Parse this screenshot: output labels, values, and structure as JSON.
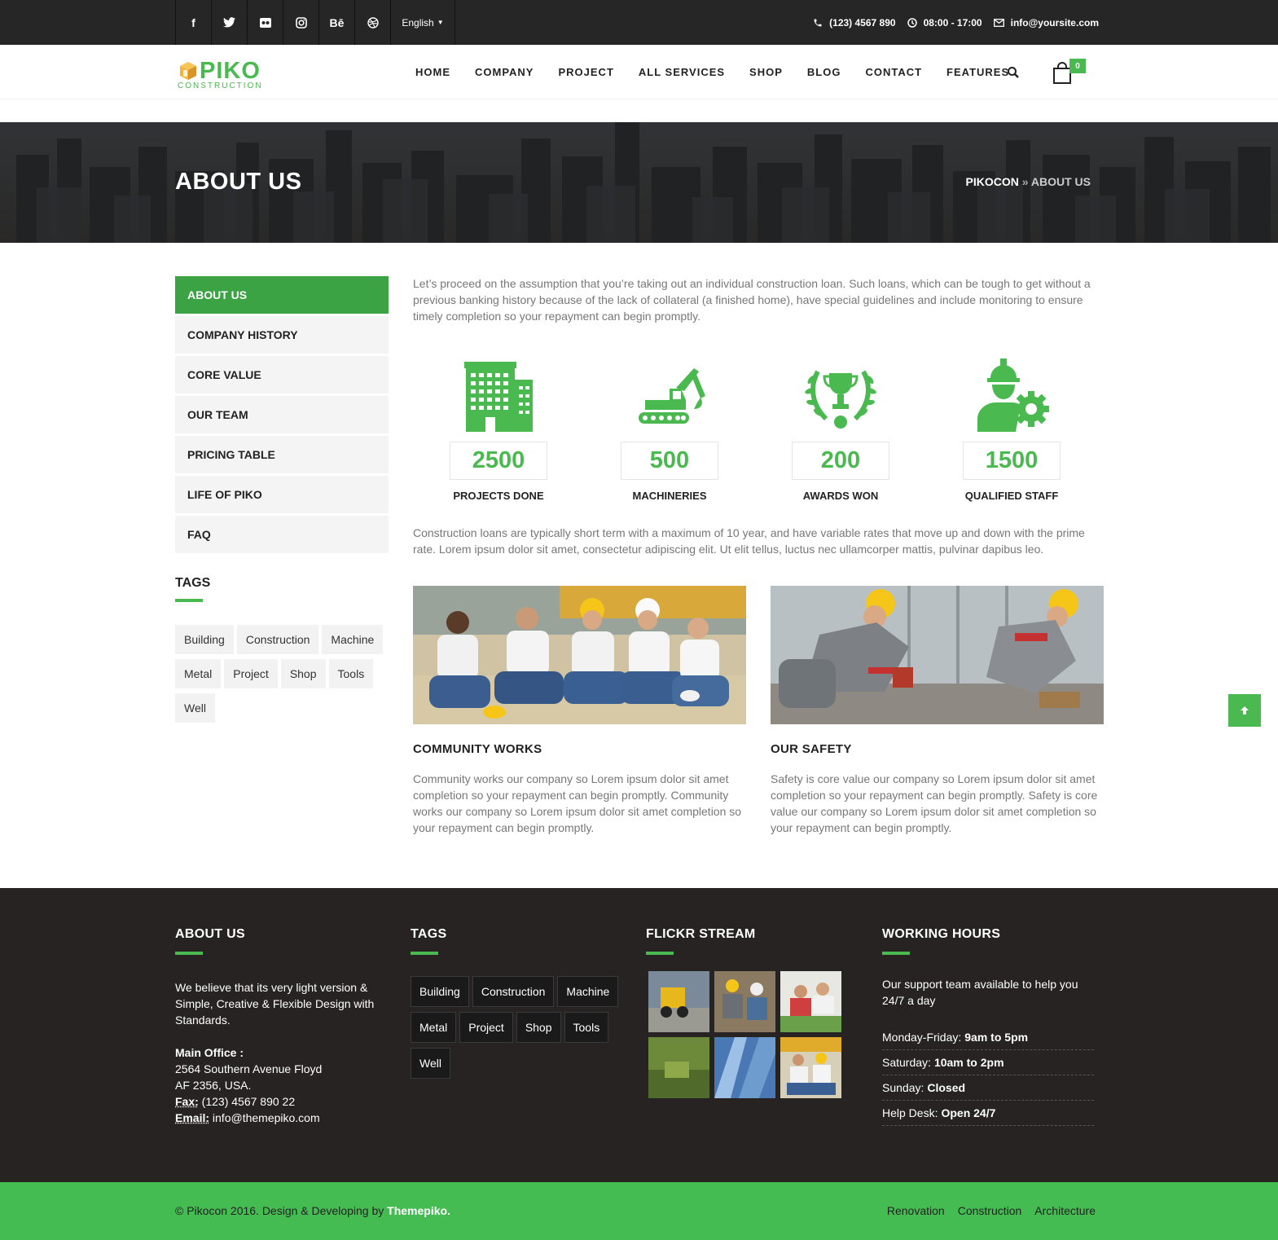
{
  "topbar": {
    "social": [
      {
        "icon": "facebook-icon",
        "glyph": "f"
      },
      {
        "icon": "twitter-icon",
        "glyph": "t"
      },
      {
        "icon": "flickr-icon",
        "glyph": "●●"
      },
      {
        "icon": "instagram-icon",
        "glyph": "◎"
      },
      {
        "icon": "behance-icon",
        "glyph": "Bē"
      },
      {
        "icon": "dribbble-icon",
        "glyph": "⊛"
      }
    ],
    "language": "English",
    "phone": "(123) 4567 890",
    "hours": "08:00 - 17:00",
    "email": "info@yoursite.com"
  },
  "header": {
    "logo_word": "PIKO",
    "logo_sub": "CONSTRUCTION",
    "nav": [
      "HOME",
      "COMPANY",
      "PROJECT",
      "ALL SERVICES",
      "SHOP",
      "BLOG",
      "CONTACT",
      "FEATURES"
    ],
    "cart_count": "0"
  },
  "banner": {
    "title": "ABOUT US",
    "crumb_home": "PIKOCON",
    "crumb_sep": " » ",
    "crumb_current": "ABOUT US"
  },
  "sidebar": {
    "menu": [
      "ABOUT US",
      "COMPANY HISTORY",
      "CORE VALUE",
      "OUR TEAM",
      "PRICING TABLE",
      "LIFE OF PIKO",
      "FAQ"
    ],
    "tags_title": "TAGS",
    "tags": [
      "Building",
      "Construction",
      "Machine",
      "Metal",
      "Project",
      "Shop",
      "Tools",
      "Well"
    ]
  },
  "content": {
    "intro": "Let’s proceed on the assumption that you’re taking out an individual construction loan. Such loans, which can be tough to get without a previous banking history because of the lack of collateral (a finished home), have special guidelines and include monitoring to ensure timely completion so your repayment can begin promptly.",
    "stats": [
      {
        "value": "2500",
        "label": "PROJECTS DONE",
        "icon": "building-icon"
      },
      {
        "value": "500",
        "label": "MACHINERIES",
        "icon": "excavator-icon"
      },
      {
        "value": "200",
        "label": "AWARDS WON",
        "icon": "trophy-icon"
      },
      {
        "value": "1500",
        "label": "QUALIFIED STAFF",
        "icon": "worker-gear-icon"
      }
    ],
    "second": "Construction loans are typically short term with a maximum of 10 year, and have variable rates that move up and down with the prime rate. Lorem ipsum dolor sit amet, consectetur adipiscing elit. Ut elit tellus, luctus nec ullamcorper mattis, pulvinar dapibus leo.",
    "cards": [
      {
        "title": "COMMUNITY WORKS",
        "text": "Community works our company so Lorem ipsum dolor sit amet completion so your repayment can begin promptly. Community works our company so Lorem ipsum dolor sit amet completion so your repayment can begin promptly."
      },
      {
        "title": "OUR SAFETY",
        "text": "Safety is core value our company so Lorem ipsum dolor sit amet completion so your repayment can begin promptly. Safety is core value our company so Lorem ipsum dolor sit amet completion so your repayment can begin promptly."
      }
    ]
  },
  "footer": {
    "about_title": "ABOUT US",
    "about_text": "We believe that its very light version & Simple, Creative & Flexible Design with Standards.",
    "office_label": "Main Office :",
    "address1": "2564 Southern Avenue Floyd",
    "address2": "AF 2356, USA.",
    "fax_label": "Fax:",
    "fax": " (123) 4567 890 22",
    "email_label": "Email:",
    "email": " info@themepiko.com",
    "tags_title": "TAGS",
    "tags": [
      "Building",
      "Construction",
      "Machine",
      "Metal",
      "Project",
      "Shop",
      "Tools",
      "Well"
    ],
    "flickr_title": "FLICKR STREAM",
    "hours_title": "WORKING HOURS",
    "hours_intro": "Our support team available to help you 24/7 a day",
    "hours": [
      {
        "day": "Monday-Friday:",
        "time": "9am to 5pm"
      },
      {
        "day": "Saturday:",
        "time": "10am to 2pm"
      },
      {
        "day": "Sunday:",
        "time": "Closed"
      },
      {
        "day": "Help Desk:",
        "time": "Open 24/7"
      }
    ],
    "copyright_pre": "© Pikocon 2016. Design & Developing by ",
    "copyright_brand": "Themepiko.",
    "links": [
      "Renovation",
      "Construction",
      "Architecture"
    ]
  },
  "colors": {
    "accent": "#4ab94f",
    "dark": "#262626",
    "active": "#3ca344"
  }
}
